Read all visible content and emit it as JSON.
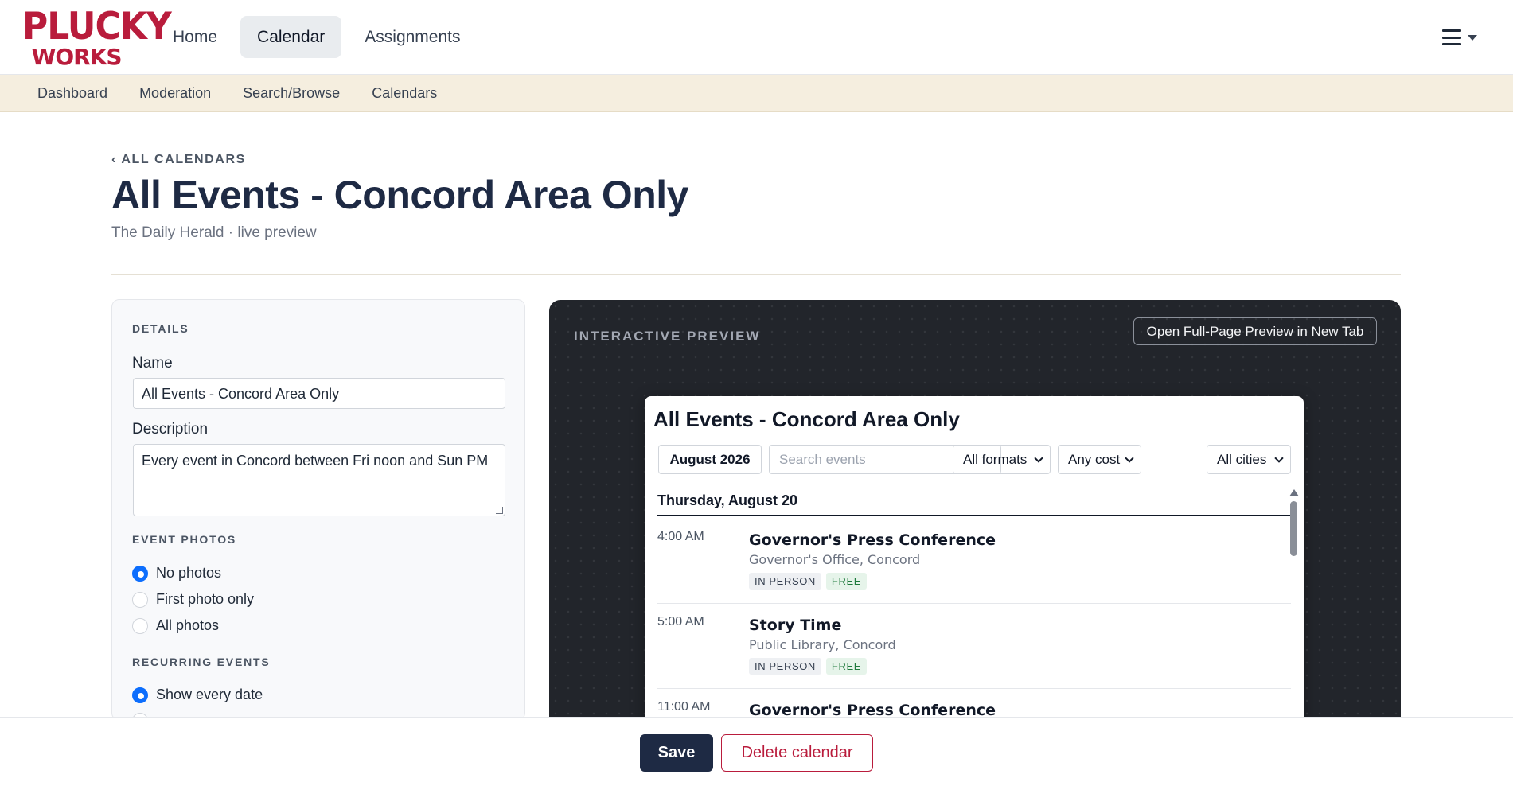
{
  "brand": {
    "line1": "PLUCKY",
    "line2": "WORKS",
    "color": "#b91c3c"
  },
  "nav": {
    "items": [
      {
        "label": "Home",
        "active": false
      },
      {
        "label": "Calendar",
        "active": true
      },
      {
        "label": "Assignments",
        "active": false
      }
    ],
    "menu_icon": "hamburger-menu-icon"
  },
  "subnav": {
    "items": [
      "Dashboard",
      "Moderation",
      "Search/Browse",
      "Calendars"
    ]
  },
  "header": {
    "back_link": "‹ ALL CALENDARS",
    "title": "All Events - Concord Area Only",
    "subtitle": "The Daily Herald · live preview"
  },
  "details": {
    "section_label": "DETAILS",
    "name_label": "Name",
    "name_value": "All Events - Concord Area Only",
    "description_label": "Description",
    "description_value": "Every event in Concord between Fri noon and Sun PM",
    "photos_label": "EVENT PHOTOS",
    "photo_options": [
      {
        "label": "No photos",
        "checked": true
      },
      {
        "label": "First photo only",
        "checked": false
      },
      {
        "label": "All photos",
        "checked": false
      }
    ],
    "recurring_label": "RECURRING EVENTS",
    "recurring_options": [
      {
        "label": "Show every date",
        "checked": true
      }
    ]
  },
  "preview": {
    "label": "INTERACTIVE PREVIEW",
    "open_full_button": "Open Full-Page Preview in New Tab",
    "widget": {
      "title": "All Events - Concord Area Only",
      "month": "August 2026",
      "search_placeholder": "Search events",
      "format_select": "All formats",
      "cost_select": "Any cost",
      "city_select": "All cities",
      "day_heading": "Thursday, August 20",
      "events": [
        {
          "time": "4:00 AM",
          "title": "Governor's Press Conference",
          "location": "Governor's Office, Concord",
          "tags": [
            "IN PERSON",
            "FREE"
          ]
        },
        {
          "time": "5:00 AM",
          "title": "Story Time",
          "location": "Public Library, Concord",
          "tags": [
            "IN PERSON",
            "FREE"
          ]
        },
        {
          "time": "11:00 AM",
          "title": "Governor's Press Conference",
          "location": "",
          "tags": []
        }
      ]
    }
  },
  "actions": {
    "save": "Save",
    "delete": "Delete calendar"
  }
}
